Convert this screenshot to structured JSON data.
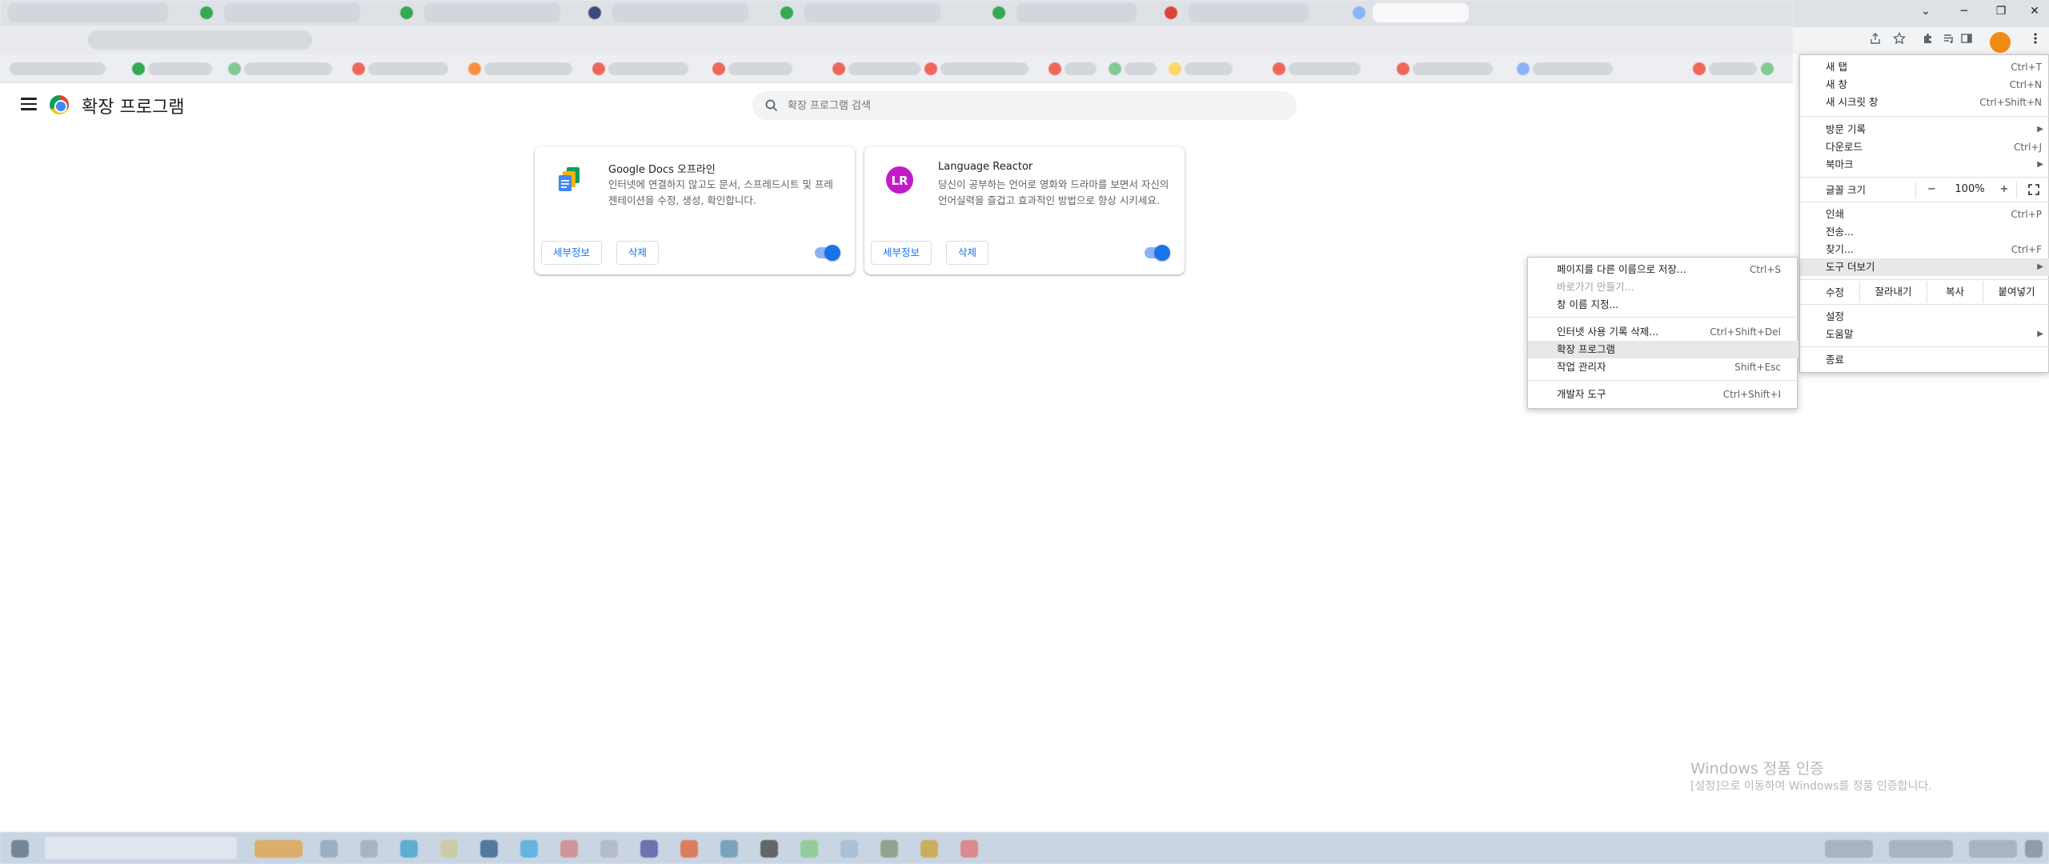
{
  "window_controls": {
    "chevron": "⌄",
    "minimize": "─",
    "restore": "❐",
    "close": "✕"
  },
  "toolbar_icons": [
    "share-icon",
    "star-icon",
    "puzzle-icon",
    "media-icon",
    "sidepanel-icon",
    "profile-avatar",
    "kebab-menu-icon"
  ],
  "page": {
    "title": "확장 프로그램",
    "search_placeholder": "확장 프로그램 검색"
  },
  "extensions": [
    {
      "name": "Google Docs 오프라인",
      "description": "인터넷에 연결하지 않고도 문서, 스프레드시트 및 프레젠테이션을 수정, 생성, 확인합니다.",
      "details_label": "세부정보",
      "remove_label": "삭제",
      "enabled": true
    },
    {
      "name": "Language Reactor",
      "description": "당신이 공부하는 언어로 영화와 드라마를 보면서 자신의 언어실력을 즐겁고 효과적인 방법으로 향상 시키세요.",
      "details_label": "세부정보",
      "remove_label": "삭제",
      "enabled": true
    }
  ],
  "main_menu": {
    "new_tab": {
      "label": "새 탭",
      "shortcut": "Ctrl+T"
    },
    "new_window": {
      "label": "새 창",
      "shortcut": "Ctrl+N"
    },
    "new_incognito": {
      "label": "새 시크릿 창",
      "shortcut": "Ctrl+Shift+N"
    },
    "history": {
      "label": "방문 기록"
    },
    "downloads": {
      "label": "다운로드",
      "shortcut": "Ctrl+J"
    },
    "bookmarks": {
      "label": "북마크"
    },
    "zoom": {
      "label": "글꼴 크기",
      "minus": "−",
      "value": "100%",
      "plus": "+"
    },
    "print": {
      "label": "인쇄",
      "shortcut": "Ctrl+P"
    },
    "cast": {
      "label": "전송..."
    },
    "find": {
      "label": "찾기...",
      "shortcut": "Ctrl+F"
    },
    "more_tools": {
      "label": "도구 더보기"
    },
    "edit": {
      "label": "수정",
      "cut": "잘라내기",
      "copy": "복사",
      "paste": "붙여넣기"
    },
    "settings": {
      "label": "설정"
    },
    "help": {
      "label": "도움말"
    },
    "exit": {
      "label": "종료"
    }
  },
  "submenu": {
    "save_page": {
      "label": "페이지를 다른 이름으로 저장...",
      "shortcut": "Ctrl+S"
    },
    "create_shortcut": {
      "label": "바로가기 만들기..."
    },
    "name_window": {
      "label": "창 이름 지정..."
    },
    "clear_data": {
      "label": "인터넷 사용 기록 삭제...",
      "shortcut": "Ctrl+Shift+Del"
    },
    "extensions": {
      "label": "확장 프로그램"
    },
    "task_manager": {
      "label": "작업 관리자",
      "shortcut": "Shift+Esc"
    },
    "dev_tools": {
      "label": "개발자 도구",
      "shortcut": "Ctrl+Shift+I"
    }
  },
  "watermark": {
    "title": "Windows 정품 인증",
    "subtitle": "[설정]으로 이동하여 Windows를 정품 인증합니다."
  },
  "colors": {
    "accent": "#1a73e8",
    "menu_hover": "#e8e8e8",
    "profile": "#f28b13"
  }
}
